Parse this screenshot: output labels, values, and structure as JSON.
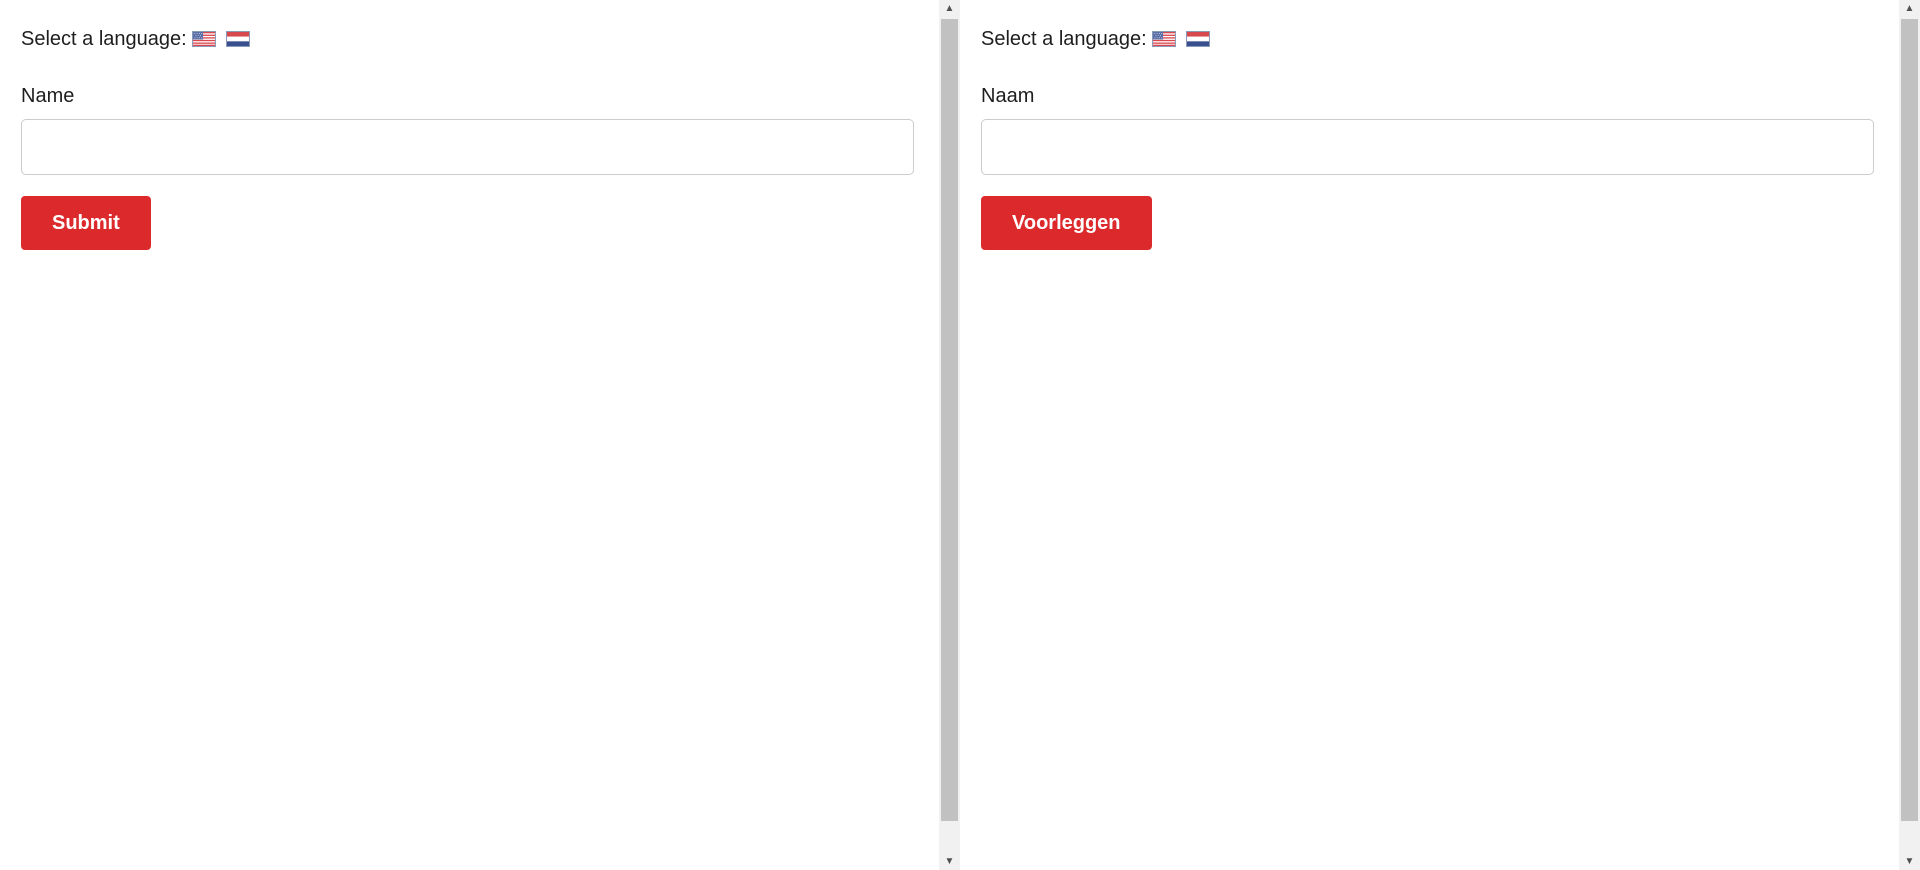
{
  "frames": [
    {
      "language_prompt": "Select a language:",
      "flags": [
        "us-flag-icon",
        "nl-flag-icon"
      ],
      "name_label": "Name",
      "name_value": "",
      "name_placeholder": "",
      "submit_label": "Submit"
    },
    {
      "language_prompt": "Select a language:",
      "flags": [
        "us-flag-icon",
        "nl-flag-icon"
      ],
      "name_label": "Naam",
      "name_value": "",
      "name_placeholder": "",
      "submit_label": "Voorleggen"
    }
  ],
  "colors": {
    "button_bg": "#dc292c",
    "button_text": "#ffffff",
    "input_border": "#cccccc",
    "scrollbar_track": "#f1f1f1",
    "scrollbar_thumb": "#c1c1c1"
  }
}
